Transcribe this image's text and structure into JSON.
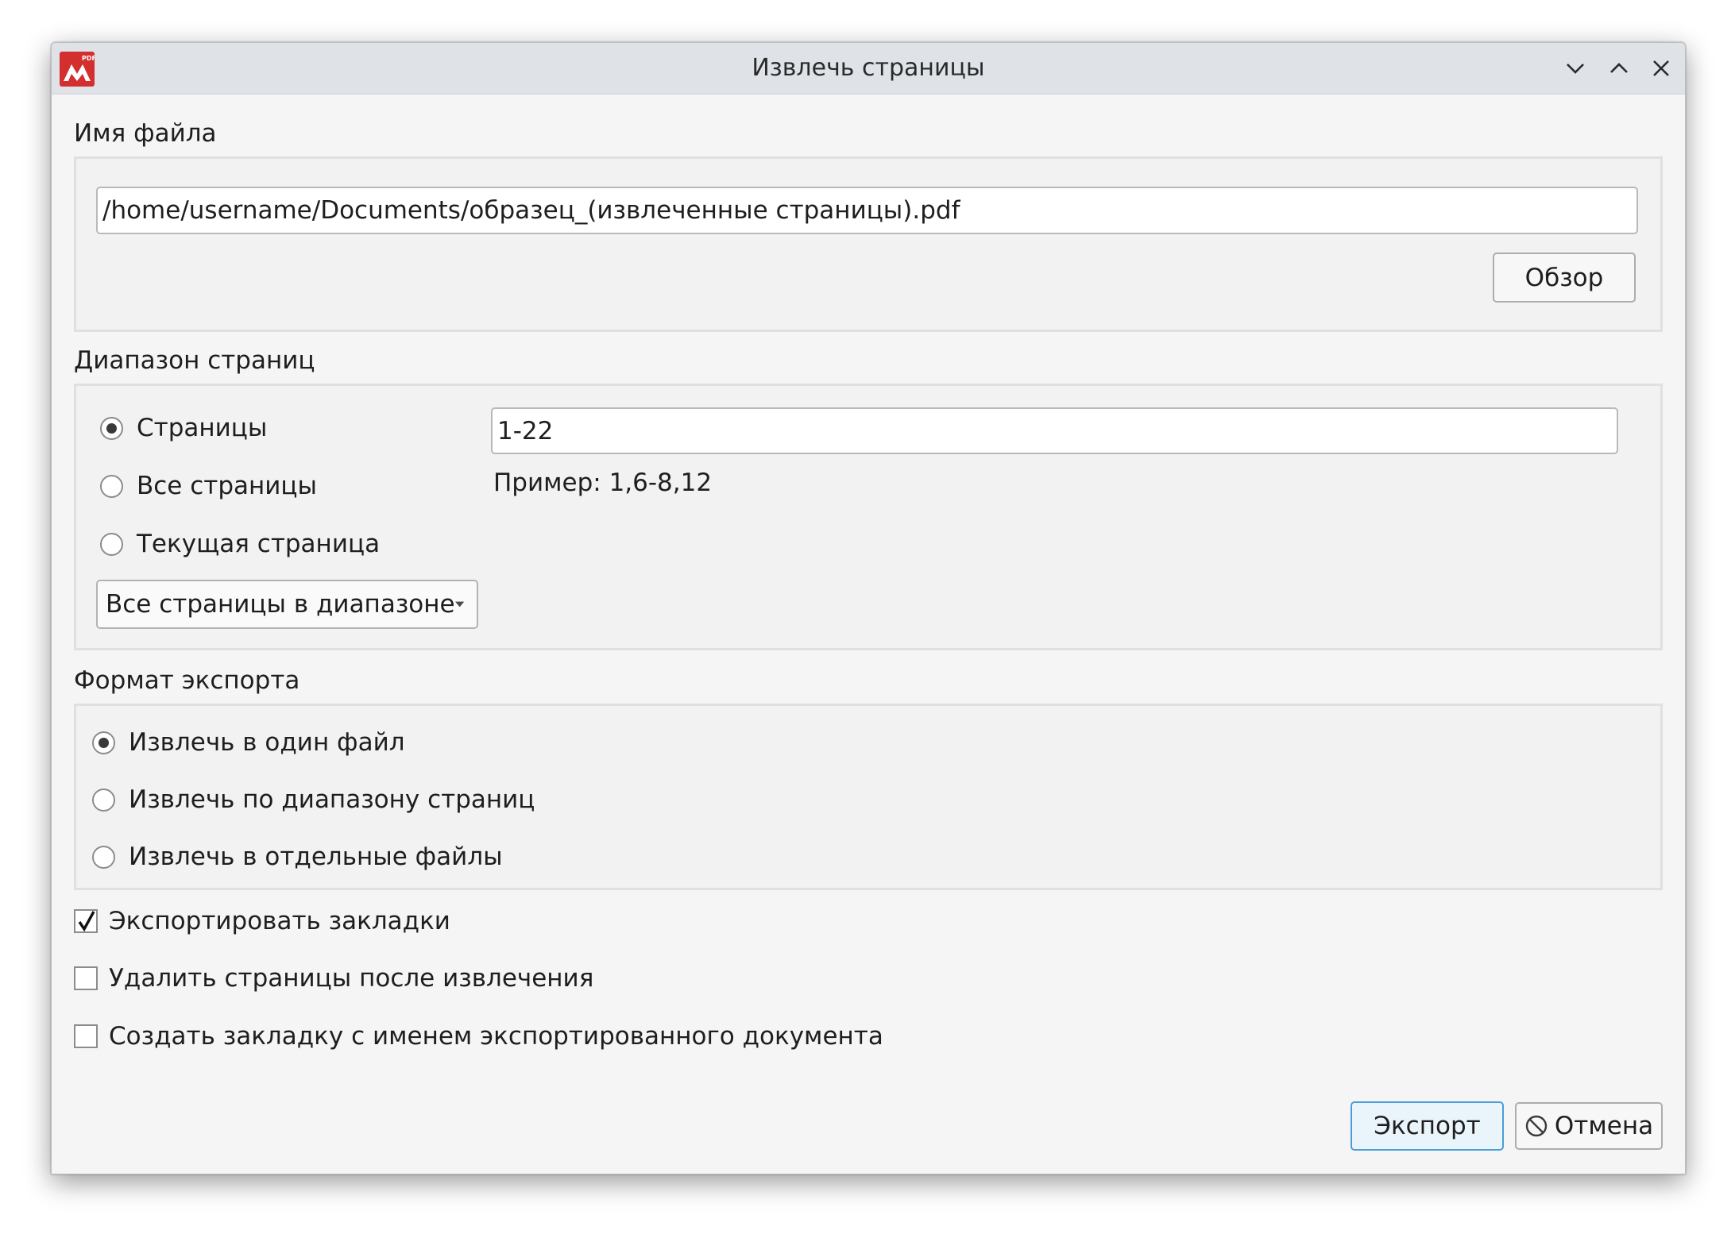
{
  "window": {
    "title": "Извлечь страницы",
    "app_icon": "pdf-app-logo-icon",
    "controls": [
      "minimize-icon",
      "maximize-icon",
      "close-icon"
    ]
  },
  "filename_section": {
    "label": "Имя файла",
    "path_value": "/home/username/Documents/образец_(извлеченные страницы).pdf",
    "browse_label": "Обзор"
  },
  "range_section": {
    "label": "Диапазон страниц",
    "options": [
      {
        "label": "Страницы",
        "selected": true
      },
      {
        "label": "Все страницы",
        "selected": false
      },
      {
        "label": "Текущая страница",
        "selected": false
      }
    ],
    "pages_value": "1-22",
    "example_text": "Пример: 1,6-8,12",
    "subset_selected": "Все страницы в диапазоне"
  },
  "format_section": {
    "label": "Формат экспорта",
    "options": [
      {
        "label": "Извлечь в один файл",
        "selected": true
      },
      {
        "label": "Извлечь по диапазону страниц",
        "selected": false
      },
      {
        "label": "Извлечь в отдельные файлы",
        "selected": false
      }
    ]
  },
  "checkboxes": [
    {
      "label": "Экспортировать закладки",
      "checked": true
    },
    {
      "label": "Удалить страницы после извлечения",
      "checked": false
    },
    {
      "label": "Создать закладку с именем экспортированного документа",
      "checked": false
    }
  ],
  "buttons": {
    "export_label": "Экспорт",
    "cancel_label": "Отмена",
    "cancel_icon": "prohibited-icon"
  },
  "colors": {
    "titlebar": "#dfe3e8",
    "dialog_bg": "#f5f5f5",
    "app_icon_red": "#d32f2f",
    "default_button_border": "#4a9ed8"
  }
}
